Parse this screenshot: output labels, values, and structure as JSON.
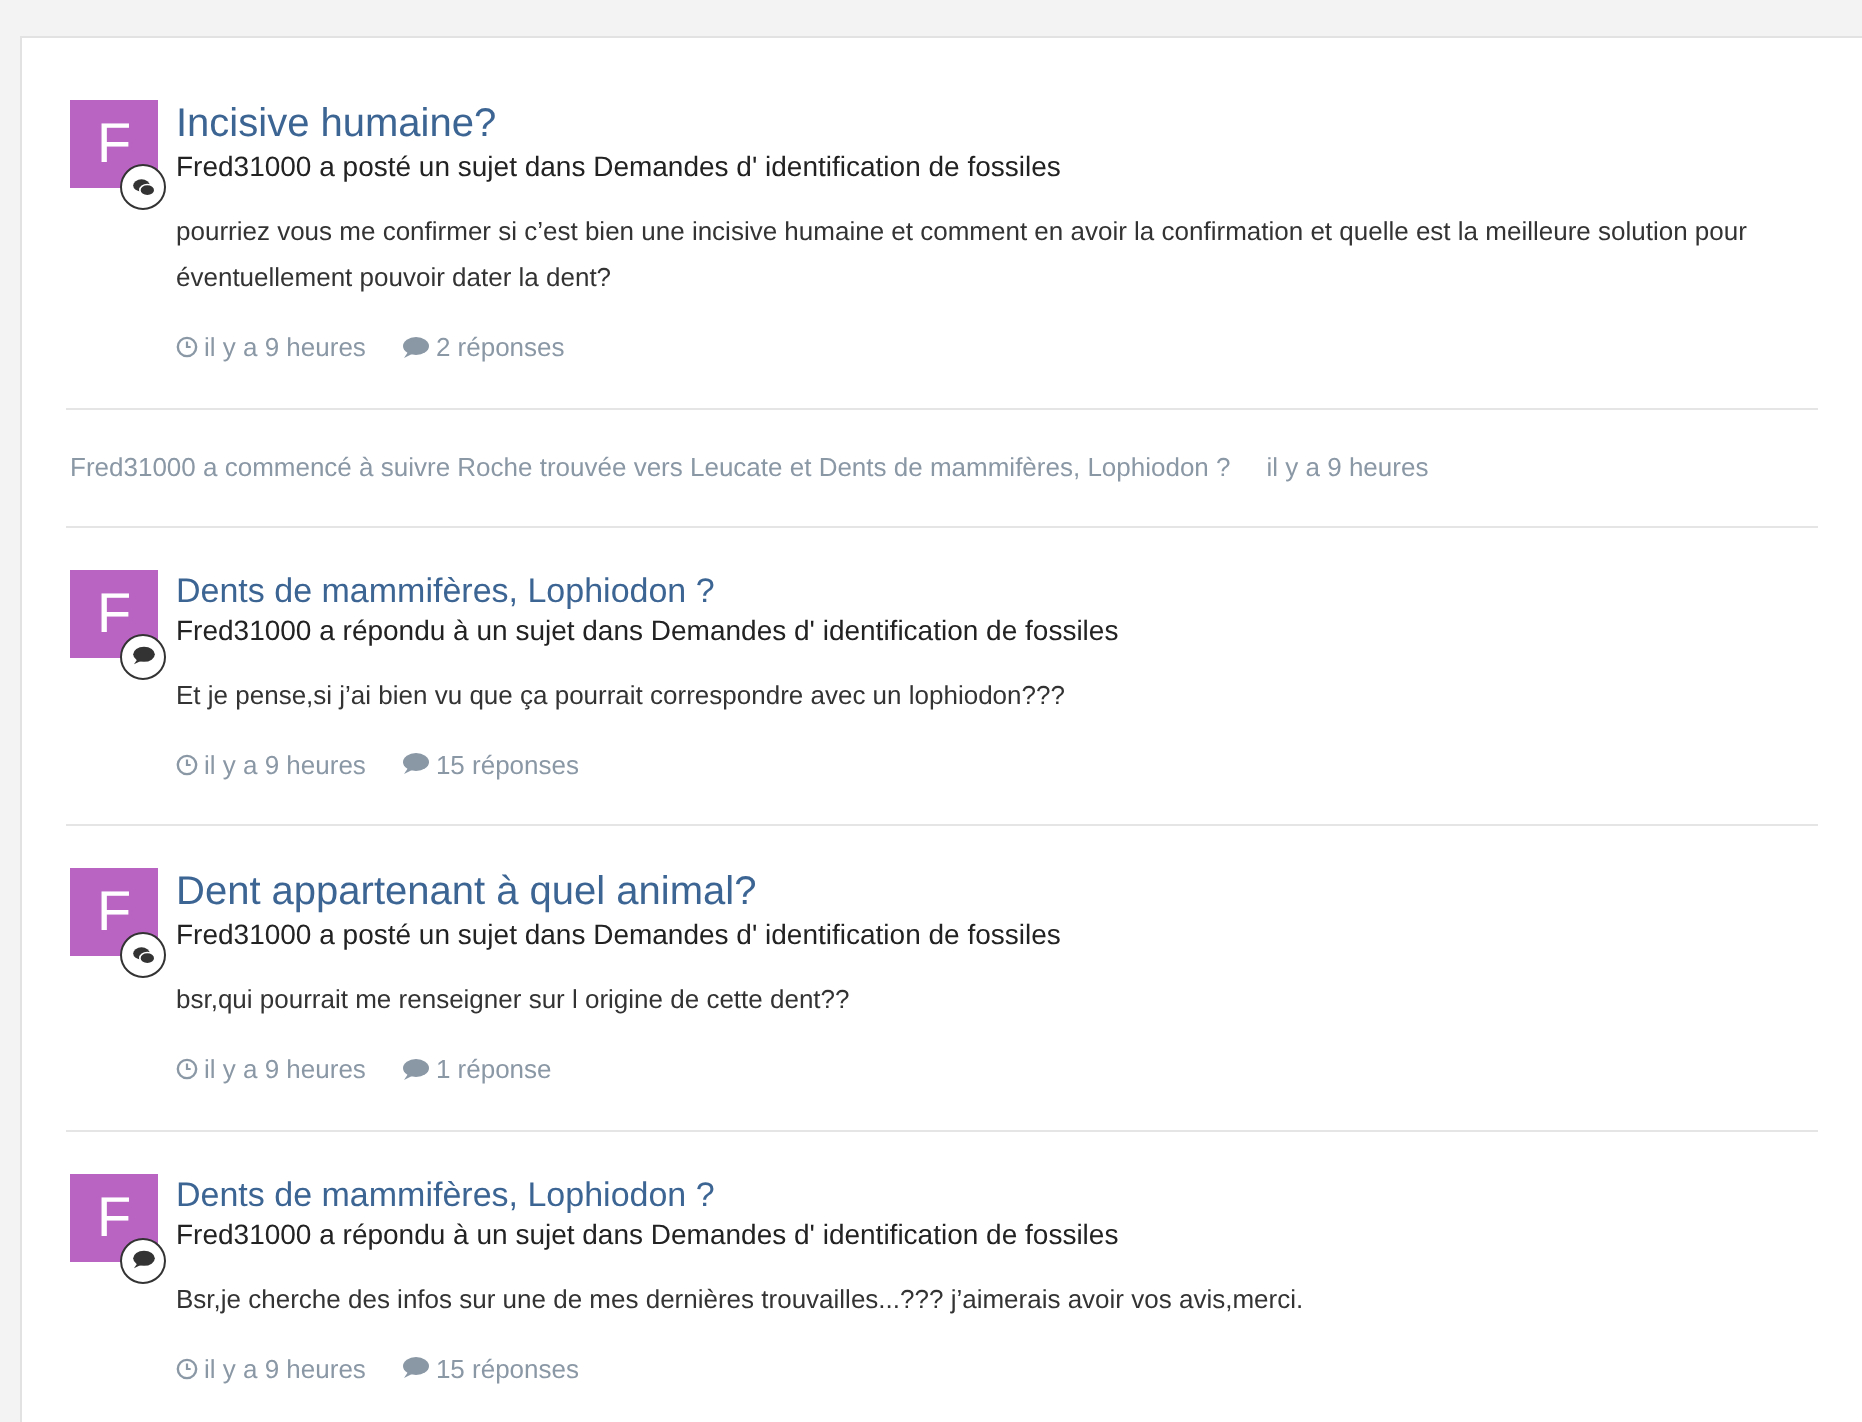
{
  "feed": [
    {
      "kind": "topic",
      "avatar_letter": "F",
      "title": "Incisive humaine?",
      "summary": "Fred31000 a posté un sujet dans Demandes d' identification de fossiles",
      "body": "pourriez vous me confirmer si c’est bien une incisive humaine et comment en avoir la confirmation et quelle est la meilleure solution pour éventuellement pouvoir dater la dent?",
      "time": "il y a 9 heures",
      "replies": "2 réponses"
    },
    {
      "kind": "follow",
      "text": "Fred31000 a commencé à suivre Roche trouvée vers Leucate et Dents de mammifères, Lophiodon ?",
      "time": "il y a 9 heures"
    },
    {
      "kind": "reply",
      "avatar_letter": "F",
      "title": "Dents de mammifères, Lophiodon ?",
      "summary": "Fred31000 a répondu à un sujet dans Demandes d' identification de fossiles",
      "body": "Et je pense,si j’ai bien vu que ça pourrait correspondre avec un lophiodon???",
      "time": "il y a 9 heures",
      "replies": "15 réponses"
    },
    {
      "kind": "topic",
      "avatar_letter": "F",
      "title": "Dent appartenant à quel animal?",
      "summary": "Fred31000 a posté un sujet dans Demandes d' identification de fossiles",
      "body": "bsr,qui pourrait me renseigner sur l origine de cette dent??",
      "time": "il y a 9 heures",
      "replies": "1 réponse"
    },
    {
      "kind": "reply",
      "avatar_letter": "F",
      "title": "Dents de mammifères, Lophiodon ?",
      "summary": "Fred31000 a répondu à un sujet dans Demandes d' identification de fossiles",
      "body": "Bsr,je cherche des infos sur une de mes dernières trouvailles...??? j’aimerais avoir vos avis,merci.",
      "time": "il y a 9 heures",
      "replies": "15 réponses"
    }
  ]
}
